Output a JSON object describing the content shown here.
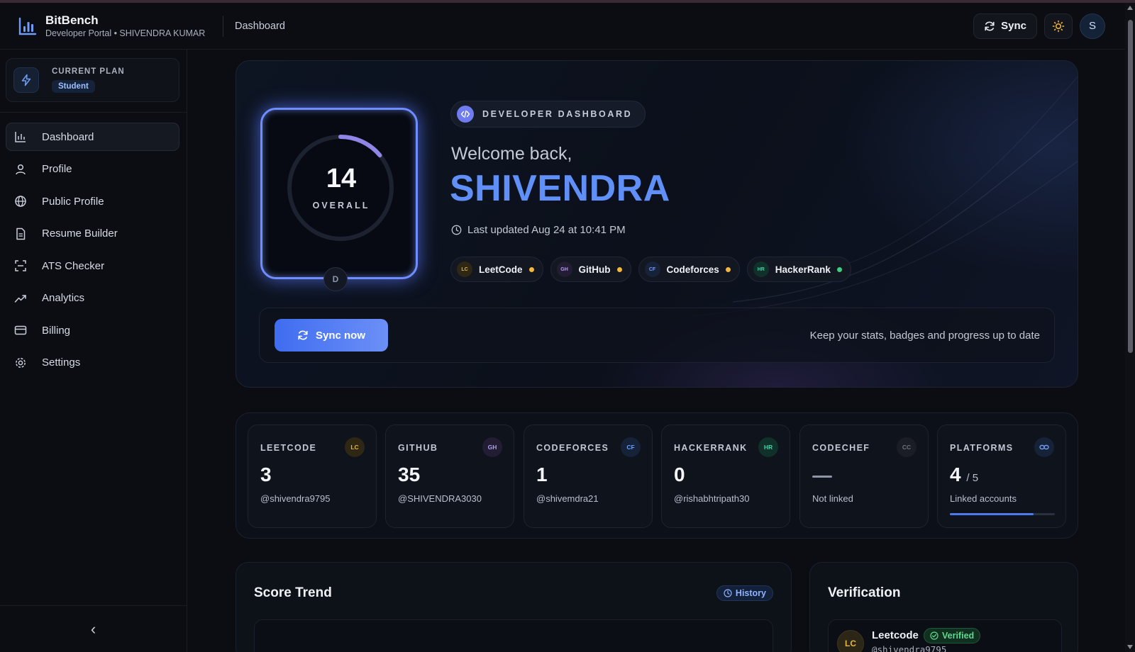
{
  "header": {
    "app_name": "BitBench",
    "subtitle": "Developer Portal • SHIVENDRA KUMAR",
    "breadcrumb": "Dashboard",
    "sync_label": "Sync",
    "avatar_initial": "S"
  },
  "sidebar": {
    "plan_label": "CURRENT PLAN",
    "plan_name": "Student",
    "items": [
      {
        "label": "Dashboard",
        "icon": "bar-chart-icon",
        "active": true
      },
      {
        "label": "Profile",
        "icon": "user-icon"
      },
      {
        "label": "Public Profile",
        "icon": "globe-icon"
      },
      {
        "label": "Resume Builder",
        "icon": "document-icon"
      },
      {
        "label": "ATS Checker",
        "icon": "scan-icon"
      },
      {
        "label": "Analytics",
        "icon": "trend-icon"
      },
      {
        "label": "Billing",
        "icon": "card-icon"
      },
      {
        "label": "Settings",
        "icon": "gear-icon"
      }
    ],
    "collapse_glyph": "‹"
  },
  "hero": {
    "score": "14",
    "score_caption": "OVERALL",
    "score_fraction": 0.14,
    "grade": "D",
    "pill": "DEVELOPER DASHBOARD",
    "welcome": "Welcome back,",
    "name": "SHIVENDRA",
    "last_updated": "Last updated Aug 24 at 10:41 PM",
    "platforms": [
      {
        "abbr": "LC",
        "name": "LeetCode",
        "status_color": "#f5b73c",
        "badge_bg": "#2d2714",
        "badge_fg": "#e7b446"
      },
      {
        "abbr": "GH",
        "name": "GitHub",
        "status_color": "#f5b73c",
        "badge_bg": "#221d33",
        "badge_fg": "#b49cf0"
      },
      {
        "abbr": "CF",
        "name": "Codeforces",
        "status_color": "#f5b73c",
        "badge_bg": "#162238",
        "badge_fg": "#6f9cf5"
      },
      {
        "abbr": "HR",
        "name": "HackerRank",
        "status_color": "#3ed07f",
        "badge_bg": "#10302a",
        "badge_fg": "#3fd3a5"
      }
    ],
    "sync_now": "Sync now",
    "sync_hint": "Keep your stats, badges and progress up to date"
  },
  "stats": [
    {
      "label": "LEETCODE",
      "abbr": "LC",
      "value": "3",
      "sub": "@shivendra9795",
      "badge_bg": "#2d2714",
      "badge_fg": "#e7b446"
    },
    {
      "label": "GITHUB",
      "abbr": "GH",
      "value": "35",
      "sub": "@SHIVENDRA3030",
      "badge_bg": "#221d33",
      "badge_fg": "#b49cf0"
    },
    {
      "label": "CODEFORCES",
      "abbr": "CF",
      "value": "1",
      "sub": "@shivemdra21",
      "badge_bg": "#162238",
      "badge_fg": "#6f9cf5"
    },
    {
      "label": "HACKERRANK",
      "abbr": "HR",
      "value": "0",
      "sub": "@rishabhtripath30",
      "badge_bg": "#10302a",
      "badge_fg": "#3fd3a5"
    },
    {
      "label": "CODECHEF",
      "abbr": "CC",
      "value": "",
      "sub": "Not linked",
      "badge_bg": "#1a1d25",
      "badge_fg": "#6b7180"
    },
    {
      "label": "PLATFORMS",
      "abbr": "link",
      "value": "4",
      "value_suffix": "/ 5",
      "sub": "Linked accounts",
      "progress": 0.8,
      "badge_bg": "#162238",
      "badge_fg": "#6f9cf5"
    }
  ],
  "score_trend": {
    "title": "Score Trend",
    "history_label": "History"
  },
  "verification": {
    "title": "Verification",
    "entries": [
      {
        "abbr": "LC",
        "platform": "Leetcode",
        "status": "Verified",
        "handle": "@shivendra9795"
      }
    ]
  }
}
